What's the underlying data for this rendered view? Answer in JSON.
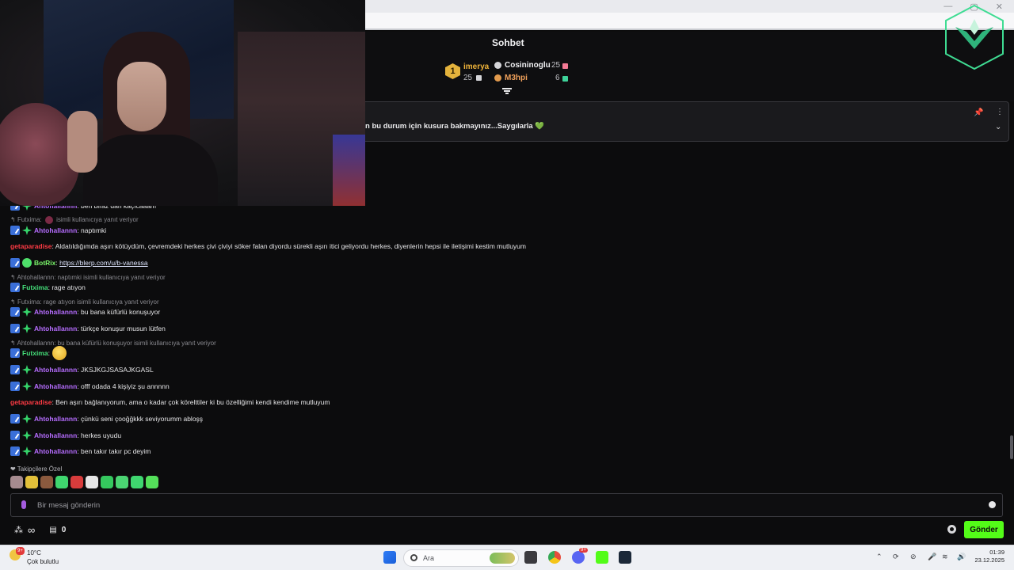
{
  "colors": {
    "accent": "#53fc18",
    "bg": "#0c0c0d",
    "purple_user": "#b66dff",
    "red_user": "#ff3b44",
    "green_user": "#45e07a"
  },
  "chat": {
    "title": "Sohbet",
    "leaderboard": [
      {
        "rank": "1",
        "name": "imerya",
        "value": "25"
      },
      {
        "name": "Cosininoglu",
        "value": "25"
      },
      {
        "name": "M3hpi",
        "value": "6"
      }
    ],
    "pinned_text": "n bu durum için kusura bakmayınız...Saygılarla 💚"
  },
  "messages": [
    {
      "type": "msg",
      "user": "Ahtohallannn",
      "text": ": ben biraz dan kaçıcaaam"
    },
    {
      "type": "reply",
      "text": "Futxima:",
      "text2": "isimli kullanıcıya yanıt veriyor"
    },
    {
      "type": "msg",
      "user": "Ahtohallannn",
      "text": ": naptımki"
    },
    {
      "type": "msg",
      "user": "getaparadise",
      "text": ": Aldatıldığımda aşırı kötüydüm, çevremdeki herkes çivi çiviyi söker falan diyordu sürekli aşırı itici geliyordu herkes, diyenlerin hepsi ile iletişimi kestim mutluyum"
    },
    {
      "type": "msg",
      "user": "BotRix",
      "text": ": ",
      "link": "https://blerp.com/u/b-vanessa"
    },
    {
      "type": "reply",
      "text": "Ahtohallannn: naptımki isimli kullanıcıya yanıt veriyor"
    },
    {
      "type": "msg",
      "user": "Futxima",
      "text": ": rage atıyon"
    },
    {
      "type": "reply",
      "text": "Futxima: rage atıyon isimli kullanıcıya yanıt veriyor"
    },
    {
      "type": "msg",
      "user": "Ahtohallannn",
      "text": ": bu bana küfürlü konuşuyor"
    },
    {
      "type": "msg",
      "user": "Ahtohallannn",
      "text": ": türkçe konuşur musun lütfen"
    },
    {
      "type": "reply",
      "text": "Ahtohallannn: bu bana küfürlü konuşuyor isimli kullanıcıya yanıt veriyor"
    },
    {
      "type": "msg",
      "user": "Futxima",
      "text": ":"
    },
    {
      "type": "msg",
      "user": "Ahtohallannn",
      "text": ": JKSJKGJSASAJKGASL"
    },
    {
      "type": "msg",
      "user": "Ahtohallannn",
      "text": ": offf odada 4 kişiyiz şu annnnn"
    },
    {
      "type": "msg",
      "user": "getaparadise",
      "text": ": Ben aşırı bağlanıyorum, ama o kadar çok körelttiler ki bu özelliğimi kendi kendime mutluyum"
    },
    {
      "type": "msg",
      "user": "Ahtohallannn",
      "text": ": çünkü seni çooğğkkk seviyorumm abloşş"
    },
    {
      "type": "msg",
      "user": "Ahtohallannn",
      "text": ": herkes uyudu"
    },
    {
      "type": "msg",
      "user": "Ahtohallannn",
      "text": ": ben takır takır pc deyim"
    }
  ],
  "followers_label": "❤ Takipçilere Özel",
  "input": {
    "placeholder": "Bir mesaj gönderin"
  },
  "bottom": {
    "infinity": "∞",
    "count": "0",
    "send_label": "Gönder"
  },
  "taskbar": {
    "temp": "10°C",
    "weather": "Çok bulutlu",
    "weather_badge": "9+",
    "search_placeholder": "Ara",
    "discord_badge": "9+",
    "time": "01:39",
    "date": "23.12.2025"
  }
}
